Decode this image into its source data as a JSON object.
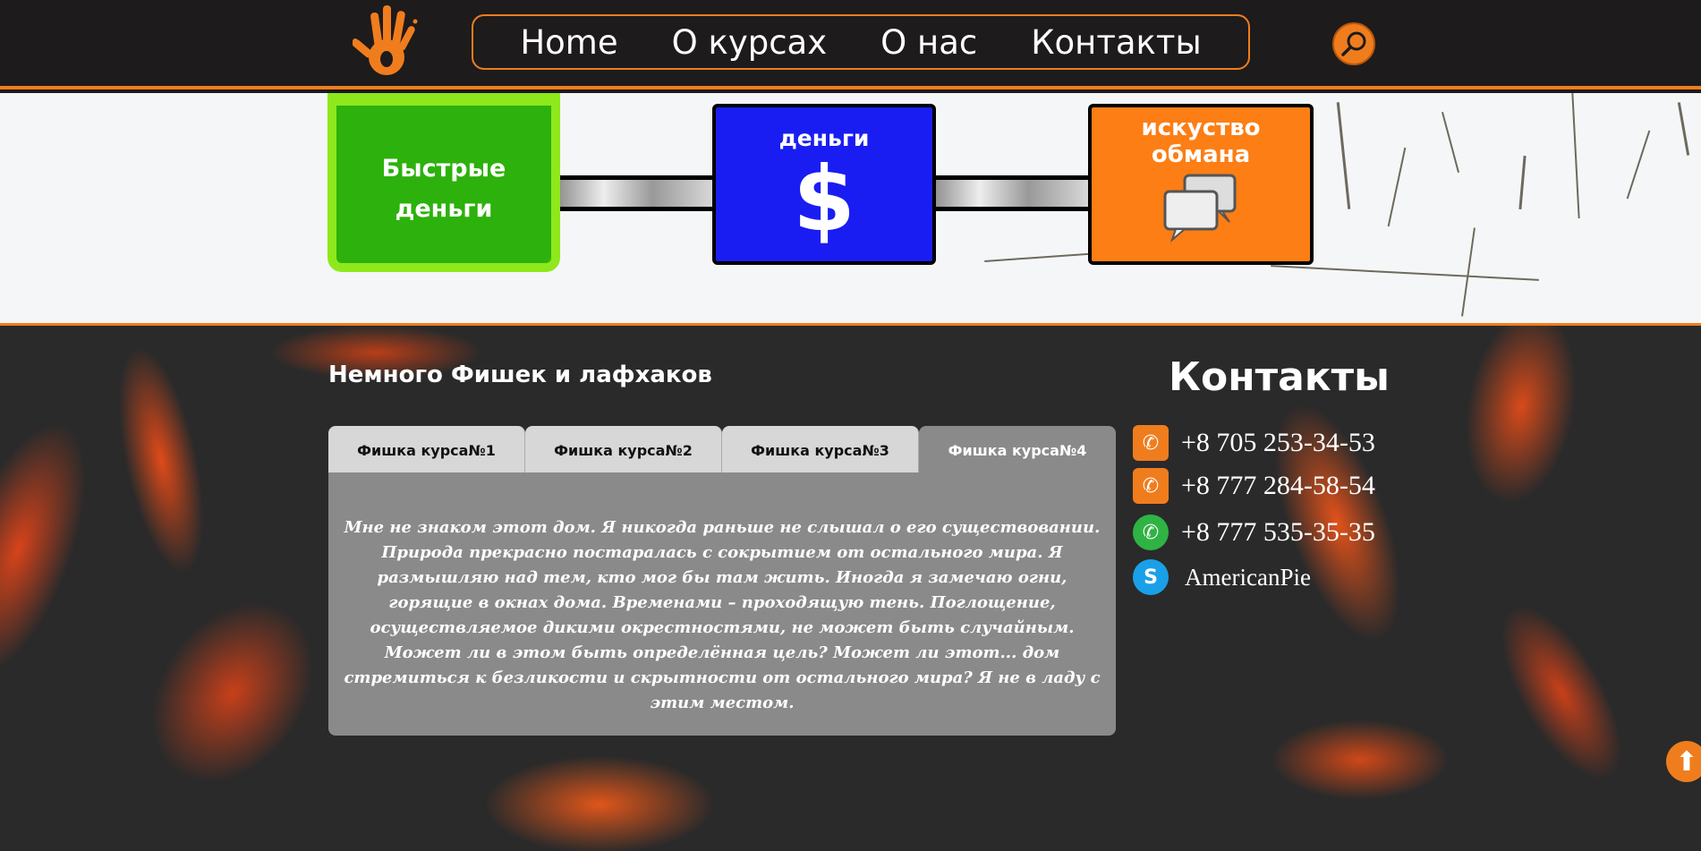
{
  "nav": {
    "items": [
      "Home",
      "О курсах",
      "О нас",
      "Контакты"
    ]
  },
  "banner": {
    "cards": [
      {
        "text_line1": "Быстрые",
        "text_line2": "деньги"
      },
      {
        "text": "деньги",
        "symbol": "$"
      },
      {
        "text_line1": "искуство",
        "text_line2": "обмана"
      }
    ]
  },
  "tips": {
    "title": "Немного Фишек и лафхаков",
    "tabs": [
      "Фишка курса№1",
      "Фишка курса№2",
      "Фишка курса№3",
      "Фишка курса№4"
    ],
    "active_tab": 3,
    "content": "Мне не знаком этот дом. Я никогда раньше не слышал о его существовании. Природа прекрасно постаралась с сокрытием от остального мира. Я размышляю над тем, кто мог бы там жить. Иногда я замечаю огни, горящие в окнах дома. Временами – проходящую тень. Поглощение, осуществляемое дикими окрестностями, не может быть случайным. Может ли в этом быть определённая цель? Может ли этот... дом стремиться к безликости и скрытности от остального мира? Я не в ладу с этим местом."
  },
  "contacts": {
    "title": "Контакты",
    "items": [
      {
        "icon": "phone-icon",
        "text": "+8 705 253-34-53"
      },
      {
        "icon": "phone-icon",
        "text": "+8 777 284-58-54"
      },
      {
        "icon": "whatsapp-icon",
        "text": "+8 777 535-35-35"
      },
      {
        "icon": "skype-icon",
        "text": "AmericanPie"
      }
    ]
  },
  "colors": {
    "accent": "#f07d1d",
    "header_bg": "#1d1b1c",
    "green_card": "#2db10c",
    "blue_card": "#1a1df2",
    "orange_card": "#fc7e14"
  }
}
